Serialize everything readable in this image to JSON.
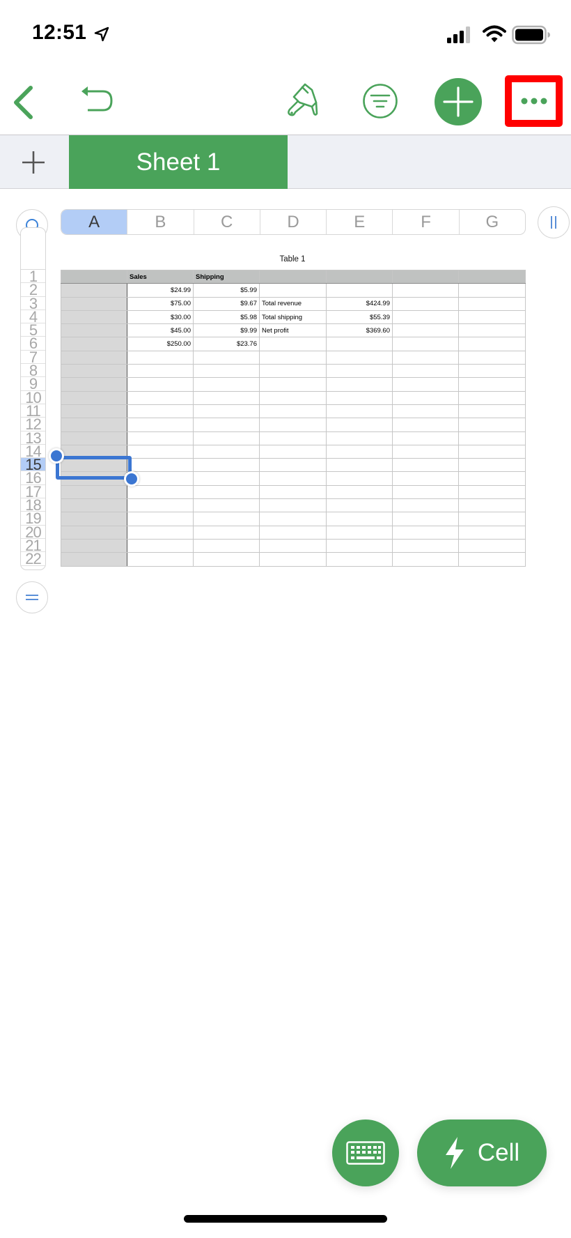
{
  "status_bar": {
    "time": "12:51",
    "icons": [
      "location-arrow-icon",
      "cellular-signal-icon",
      "wifi-icon",
      "battery-icon"
    ]
  },
  "toolbar": {
    "back_icon": "chevron-left-icon",
    "undo_icon": "undo-icon",
    "format_icon": "paintbrush-icon",
    "organize_icon": "filter-icon",
    "insert_icon": "plus-icon",
    "more_icon": "ellipsis-icon"
  },
  "sheets": {
    "add_icon": "plus-icon",
    "tabs": [
      {
        "label": "Sheet 1",
        "active": true
      }
    ]
  },
  "colors": {
    "accent": "#4aa35a",
    "selection": "#3b76d2",
    "header_selected": "#b3cdf6",
    "highlight_annotation": "#ff0000"
  },
  "grid": {
    "columns": [
      "A",
      "B",
      "C",
      "D",
      "E",
      "F",
      "G"
    ],
    "selected_column": "A",
    "rows": [
      "1",
      "2",
      "3",
      "4",
      "5",
      "6",
      "7",
      "8",
      "9",
      "10",
      "11",
      "12",
      "13",
      "14",
      "15",
      "16",
      "17",
      "18",
      "19",
      "20",
      "21",
      "22"
    ],
    "selected_row": "15",
    "selected_cell": "A15"
  },
  "table": {
    "title": "Table 1",
    "header": [
      "",
      "Sales",
      "Shipping",
      "",
      "",
      "",
      ""
    ],
    "rows": [
      [
        "",
        "$24.99",
        "$5.99",
        "",
        "",
        "",
        ""
      ],
      [
        "",
        "$75.00",
        "$9.67",
        "Total  revenue",
        "$424.99",
        "",
        ""
      ],
      [
        "",
        "$30.00",
        "$5.98",
        "Total shipping",
        "$55.39",
        "",
        ""
      ],
      [
        "",
        "$45.00",
        "$9.99",
        "Net profit",
        "$369.60",
        "",
        ""
      ],
      [
        "",
        "$250.00",
        "$23.76",
        "",
        "",
        "",
        ""
      ],
      [
        "",
        "",
        "",
        "",
        "",
        "",
        ""
      ],
      [
        "",
        "",
        "",
        "",
        "",
        "",
        ""
      ],
      [
        "",
        "",
        "",
        "",
        "",
        "",
        ""
      ],
      [
        "",
        "",
        "",
        "",
        "",
        "",
        ""
      ],
      [
        "",
        "",
        "",
        "",
        "",
        "",
        ""
      ],
      [
        "",
        "",
        "",
        "",
        "",
        "",
        ""
      ],
      [
        "",
        "",
        "",
        "",
        "",
        "",
        ""
      ],
      [
        "",
        "",
        "",
        "",
        "",
        "",
        ""
      ],
      [
        "",
        "",
        "",
        "",
        "",
        "",
        ""
      ],
      [
        "",
        "",
        "",
        "",
        "",
        "",
        ""
      ],
      [
        "",
        "",
        "",
        "",
        "",
        "",
        ""
      ],
      [
        "",
        "",
        "",
        "",
        "",
        "",
        ""
      ],
      [
        "",
        "",
        "",
        "",
        "",
        "",
        ""
      ],
      [
        "",
        "",
        "",
        "",
        "",
        "",
        ""
      ],
      [
        "",
        "",
        "",
        "",
        "",
        "",
        ""
      ],
      [
        "",
        "",
        "",
        "",
        "",
        "",
        ""
      ]
    ]
  },
  "bottom": {
    "keyboard_icon": "keyboard-icon",
    "cell_icon": "lightning-bolt-icon",
    "cell_label": "Cell"
  }
}
